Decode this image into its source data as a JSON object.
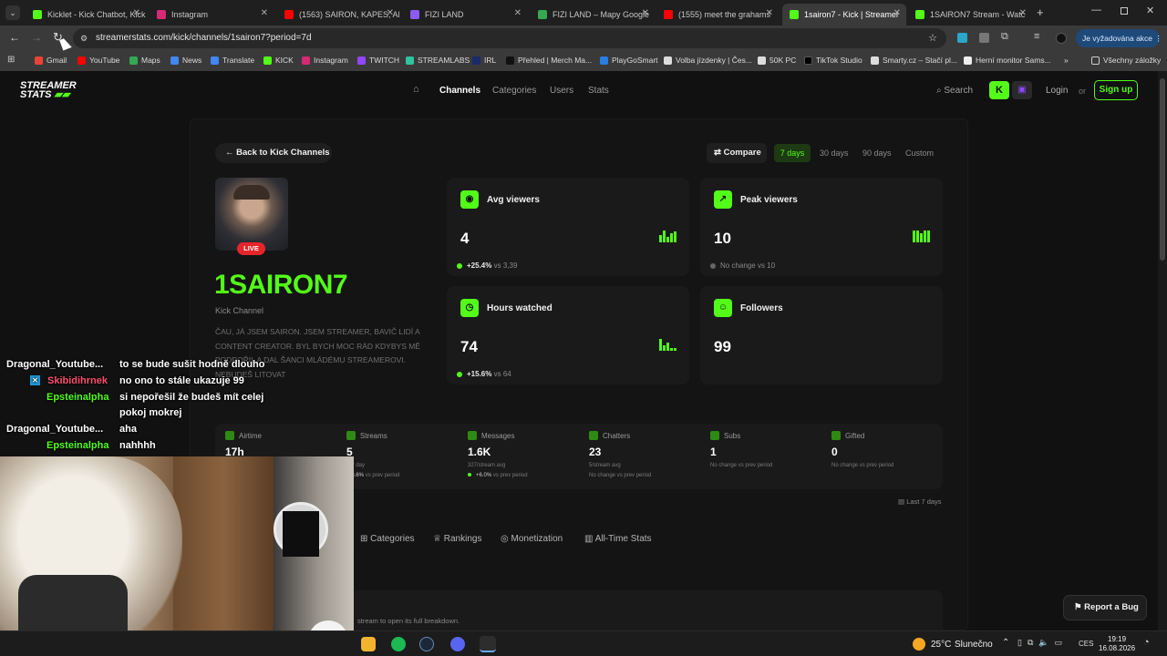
{
  "browser": {
    "tabs": [
      {
        "title": "Kicklet - Kick Chatbot, Kick",
        "color": "#53fc18"
      },
      {
        "title": "Instagram",
        "color": "#d62976"
      },
      {
        "title": "(1563) SAIRON, KAPES, AF",
        "color": "#ff0000"
      },
      {
        "title": "FIZI LAND",
        "color": "#8a5cf5"
      },
      {
        "title": "FIZI LAND – Mapy Google",
        "color": "#34a853"
      },
      {
        "title": "(1555) meet the grahams",
        "color": "#ff0000"
      },
      {
        "title": "1sairon7 - Kick | Streamer",
        "color": "#53fc18"
      },
      {
        "title": "1SAIRON7 Stream - Watc",
        "color": "#53fc18"
      }
    ],
    "url": "streamerstats.com/kick/channels/1sairon7?period=7d",
    "profile_button": "Je vyžadována akce",
    "bookmarks": [
      "Gmail",
      "YouTube",
      "Maps",
      "News",
      "Translate",
      "KICK",
      "Instagram",
      "TWITCH",
      "STREAMLABS",
      "IRL",
      "Přehled | Merch Ma...",
      "PlayGoSmart",
      "Volba jízdenky | Čes...",
      "50K PC",
      "TikTok Studio",
      "Smarty.cz – Stačí pl...",
      "Herní monitor Sams..."
    ],
    "bookmarks_more": "»",
    "all_bookmarks": "Všechny záložky"
  },
  "site": {
    "logo_line1": "STREAMER",
    "logo_line2": "STATS",
    "nav": [
      "Channels",
      "Categories",
      "Users",
      "Stats"
    ],
    "search": "Search",
    "login": "Login",
    "or": "or",
    "signup": "Sign up"
  },
  "channel": {
    "back": "Back to Kick Channels",
    "compare": "Compare",
    "periods": [
      "7 days",
      "30 days",
      "90 days",
      "Custom"
    ],
    "live_badge": "LIVE",
    "name": "1SAIRON7",
    "subtitle": "Kick Channel",
    "bio_lines": [
      "ČAU, JÁ JSEM SAIRON. JSEM STREAMER, BAVIČ LIDÍ A",
      "CONTENT CREATOR. BYL BYCH MOC RÁD KDYBYS MĚ",
      "PODPOŘIL A DAL ŠANCI MLÁDÉMU STREAMEROVI.",
      "NEBUDEŠ LITOVAT"
    ]
  },
  "cards": [
    {
      "title": "Avg viewers",
      "value": "4",
      "change": "+25.4%",
      "vs": "vs 3,39"
    },
    {
      "title": "Peak viewers",
      "value": "10",
      "change": "No change",
      "vs": "vs 10"
    },
    {
      "title": "Hours watched",
      "value": "74",
      "change": "+15.6%",
      "vs": "vs 64"
    },
    {
      "title": "Followers",
      "value": "99"
    }
  ],
  "stats": [
    {
      "label": "Airtime",
      "value": "17h"
    },
    {
      "label": "Streams",
      "value": "5",
      "sub1": "per day",
      "sub2": "-28.6%",
      "sub3": "vs prev period"
    },
    {
      "label": "Messages",
      "value": "1.6K",
      "sub1": "327/stream avg",
      "sub2": "+6.0%",
      "sub3": "vs prev period"
    },
    {
      "label": "Chatters",
      "value": "23",
      "sub1": "5/stream avg",
      "sub2": "No change",
      "sub3": "vs prev period"
    },
    {
      "label": "Subs",
      "value": "1",
      "sub2": "No change",
      "sub3": "vs prev period"
    },
    {
      "label": "Gifted",
      "value": "0",
      "sub2": "No change",
      "sub3": "vs prev period"
    }
  ],
  "last_period": "Last 7 days",
  "page_tabs": [
    "Categories",
    "Rankings",
    "Monetization",
    "All-Time Stats"
  ],
  "breakdown_hint": "stream to open its full breakdown.",
  "report_bug": "Report a Bug",
  "chat": [
    {
      "user": "Dragonal_Youtube...",
      "msg": "to se bude sušit hodně dlouho",
      "color": "#ffffff"
    },
    {
      "user": "Skibidihrnek",
      "msg": "no ono to stále ukazuje 99",
      "color": "#ff4f6e"
    },
    {
      "user": "Epsteinalpha",
      "msg": "si nepořešil že budeš mít celej",
      "color": "#53fc18"
    },
    {
      "user": "",
      "msg": "pokoj mokrej",
      "color": "#ffffff"
    },
    {
      "user": "Dragonal_Youtube...",
      "msg": "aha",
      "color": "#ffffff"
    },
    {
      "user": "Epsteinalpha",
      "msg": "nahhhh",
      "color": "#53fc18"
    }
  ],
  "taskbar": {
    "temp": "25°C",
    "weather": "Slunečno",
    "lang": "CES",
    "time": "19:19",
    "date": "16.08.2026"
  }
}
